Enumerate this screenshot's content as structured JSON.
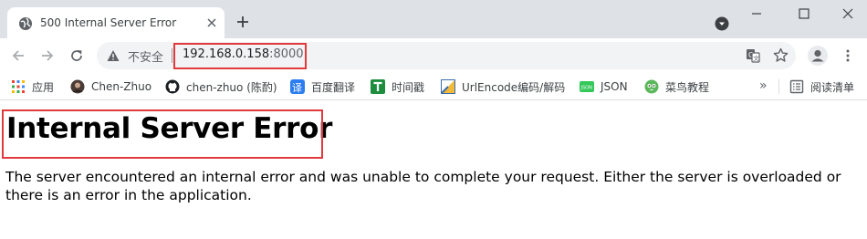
{
  "tab": {
    "title": "500 Internal Server Error",
    "favicon": "globe-icon"
  },
  "toolbar": {
    "security_label": "不安全",
    "url_host": "192.168.0.158",
    "url_port": ":8000"
  },
  "bookmarks": [
    {
      "label": "应用",
      "icon": "apps-grid-icon"
    },
    {
      "label": "Chen-Zhuo",
      "icon": "profile-photo-icon"
    },
    {
      "label": "chen-zhuo (陈酌)",
      "icon": "github-icon"
    },
    {
      "label": "百度翻译",
      "icon": "baidu-translate-icon"
    },
    {
      "label": "时间戳",
      "icon": "timestamp-icon"
    },
    {
      "label": "UrlEncode编码/解码",
      "icon": "urlencode-icon"
    },
    {
      "label": "JSON",
      "icon": "json-icon"
    },
    {
      "label": "菜鸟教程",
      "icon": "runoob-icon"
    }
  ],
  "bookmarks_more": "»",
  "reading_list": "阅读清单",
  "page": {
    "title": "Internal Server Error",
    "message": "The server encountered an internal error and was unable to complete your request. Either the server is overloaded or there is an error in the application."
  },
  "colors": {
    "tabstrip": "#dee1e6",
    "omnibox": "#f1f3f4",
    "highlight": "#e0393e"
  }
}
